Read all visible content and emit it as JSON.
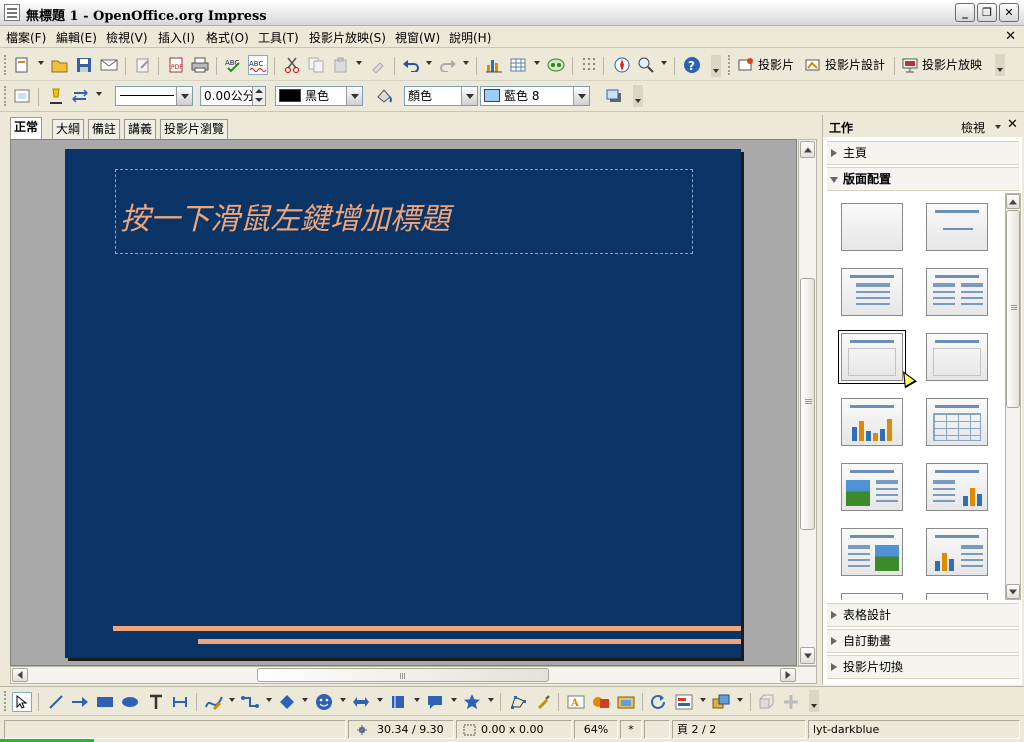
{
  "window": {
    "title": "無標題 1 - OpenOffice.org Impress",
    "minimize": "_",
    "restore": "❐",
    "close": "✕"
  },
  "menu": [
    "檔案(F)",
    "編輯(E)",
    "檢視(V)",
    "插入(I)",
    "格式(O)",
    "工具(T)",
    "投影片放映(S)",
    "視窗(W)",
    "說明(H)"
  ],
  "menu_close": "✕",
  "toolbar": {
    "slide_label": "投影片",
    "slide_design_label": "投影片設計",
    "slideshow_label": "投影片放映"
  },
  "line_toolbar": {
    "line_width": "0.00公分",
    "line_color": "黑色",
    "area_style": "顏色",
    "area_color": "藍色 8",
    "line_color_hex": "#000000",
    "area_color_hex": "#99ccff"
  },
  "view_tabs": [
    "正常",
    "大綱",
    "備註",
    "講義",
    "投影片瀏覽"
  ],
  "slide": {
    "title_placeholder": "按一下滑鼠左鍵增加標題",
    "background": "#0a3466",
    "accent": "#f0a47a"
  },
  "task_pane": {
    "title": "工作",
    "view_menu": "檢視",
    "close": "✕",
    "sections": {
      "master_pages": "主頁",
      "layouts": "版面配置",
      "table_design": "表格設計",
      "custom_animation": "自訂動畫",
      "slide_transition": "投影片切換"
    }
  },
  "status": {
    "position": "30.34 / 9.30",
    "size": "0.00 x 0.00",
    "zoom": "64%",
    "modified": "*",
    "page": "頁 2 / 2",
    "master": "lyt-darkblue"
  }
}
